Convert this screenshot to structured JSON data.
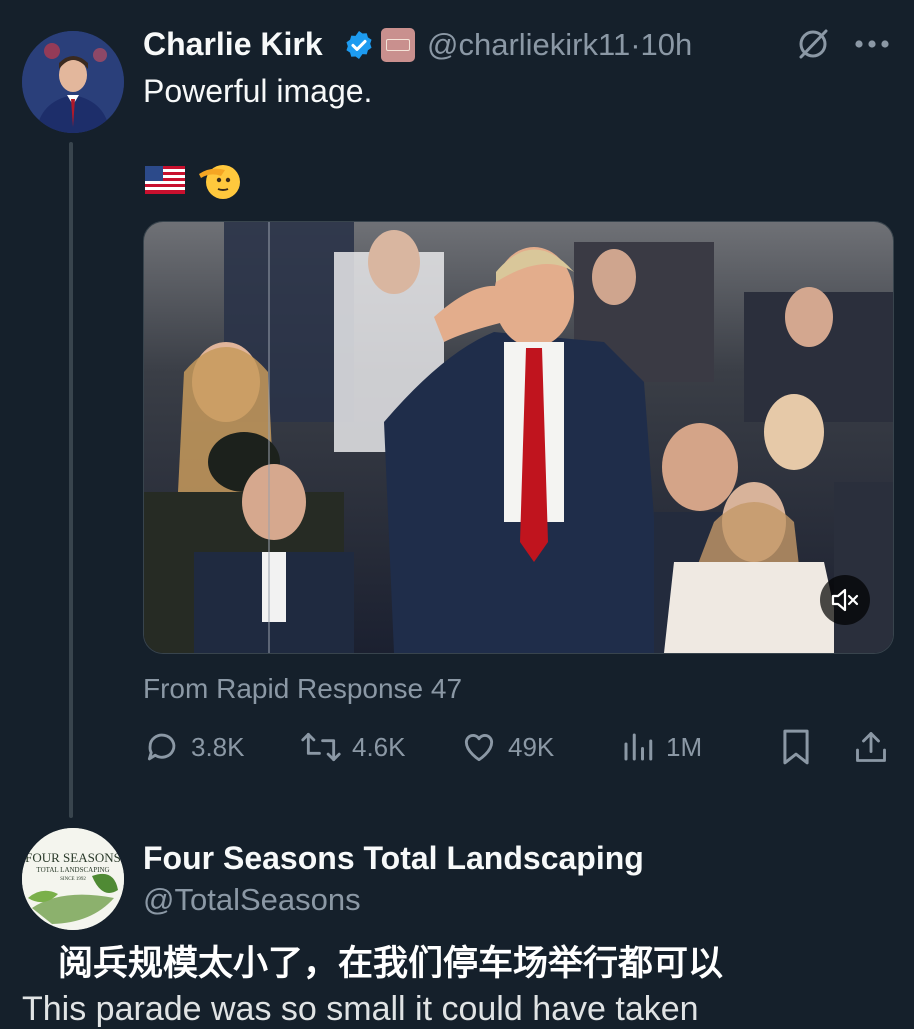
{
  "tweet": {
    "author_name": "Charlie Kirk",
    "handle": "@charliekirk11",
    "separator": "·",
    "time": "10h",
    "text": "Powerful image.",
    "emojis": "🇺🇸 🫡",
    "source": "From Rapid Response 47",
    "stats": {
      "replies": "3.8K",
      "retweets": "4.6K",
      "likes": "49K",
      "views": "1M"
    },
    "colors": {
      "verified": "#1d9bf0",
      "tie": "#c0141e",
      "suit": "#1f2d4a"
    }
  },
  "reply": {
    "author_name": "Four Seasons Total Landscaping",
    "handle": "@TotalSeasons",
    "logo_text": {
      "line1": "FOUR SEASONS",
      "line2": "TOTAL LANDSCAPING",
      "line3": "SINCE 1992"
    }
  },
  "caption": {
    "chinese": "阅兵规模太小了，在我们停车场举行都可以",
    "english_partial": "This parade was so small it could have taken"
  }
}
